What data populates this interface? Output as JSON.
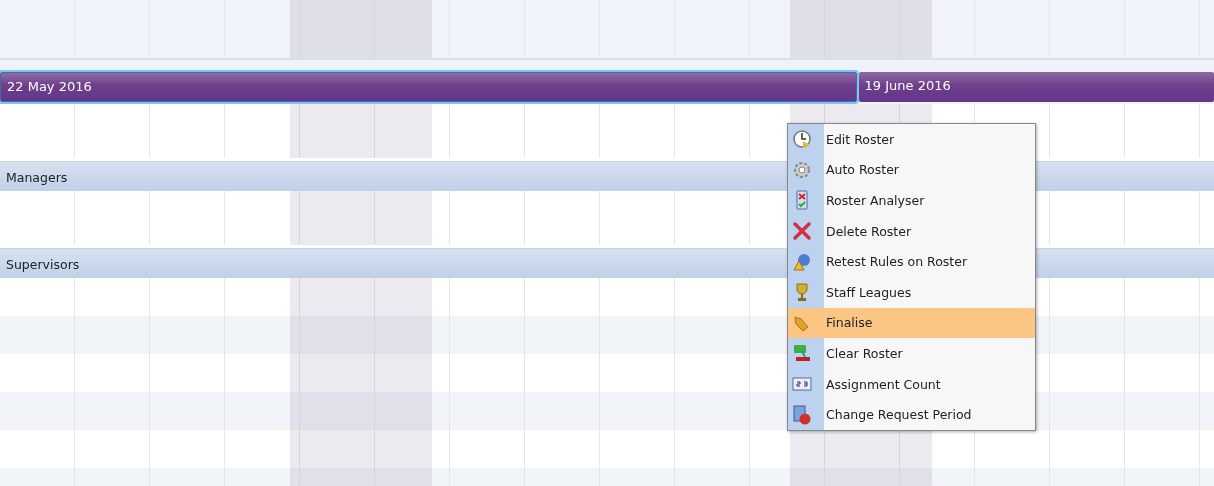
{
  "periods": [
    {
      "label": "22 May 2016",
      "selected": true
    },
    {
      "label": "19 June 2016",
      "selected": false
    }
  ],
  "groups": [
    {
      "name": "Managers"
    },
    {
      "name": "Supervisors"
    }
  ],
  "context_menu": {
    "items": [
      {
        "label": "Edit Roster",
        "selected": false
      },
      {
        "label": "Auto Roster",
        "selected": false
      },
      {
        "label": "Roster Analyser",
        "selected": false
      },
      {
        "label": "Delete Roster",
        "selected": false
      },
      {
        "label": "Retest Rules on Roster",
        "selected": false
      },
      {
        "label": "Staff Leagues",
        "selected": false
      },
      {
        "label": "Finalise",
        "selected": true
      },
      {
        "label": "Clear Roster",
        "selected": false
      },
      {
        "label": "Assignment Count",
        "selected": false
      },
      {
        "label": "Change Request Period",
        "selected": false
      }
    ]
  }
}
